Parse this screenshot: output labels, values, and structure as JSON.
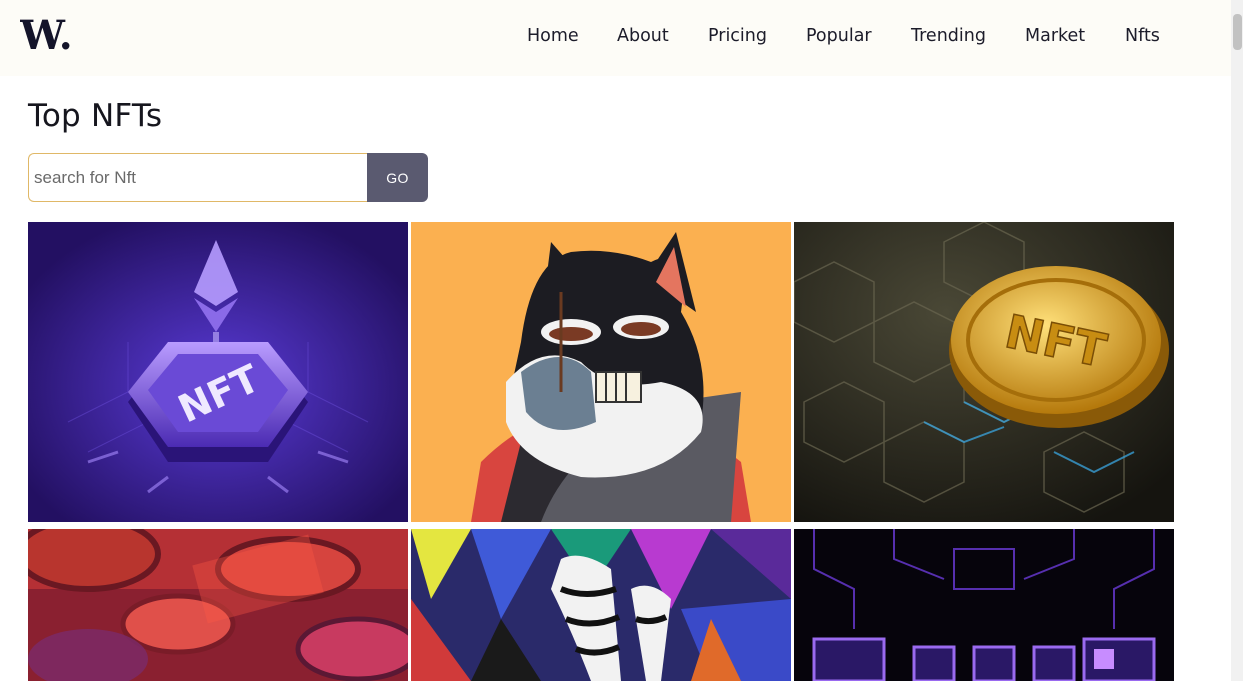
{
  "header": {
    "logo_text": "W.",
    "nav": [
      {
        "label": "Home"
      },
      {
        "label": "About"
      },
      {
        "label": "Pricing"
      },
      {
        "label": "Popular"
      },
      {
        "label": "Trending"
      },
      {
        "label": "Market"
      },
      {
        "label": "Nfts"
      }
    ]
  },
  "main": {
    "title": "Top NFTs",
    "search": {
      "placeholder": "search for Nft",
      "value": ""
    },
    "go_label": "GO",
    "cards_top_row_image_text": {
      "card1": "NFT",
      "card3": "NFT"
    }
  },
  "colors": {
    "accent_border": "#e0b867",
    "go_button": "#5a5a70",
    "header_bg": "#fdfcf7"
  }
}
